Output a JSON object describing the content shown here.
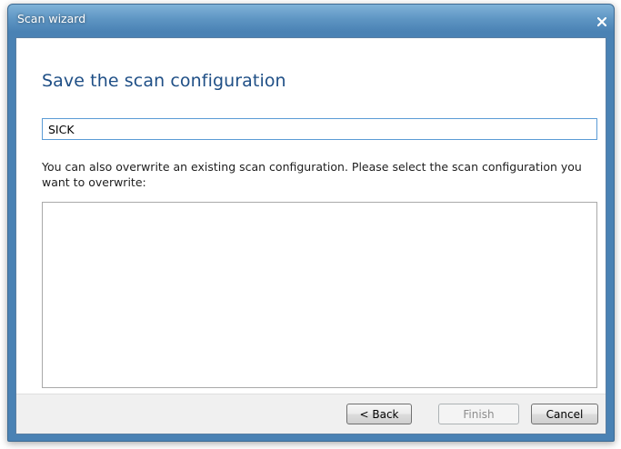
{
  "window": {
    "title": "Scan wizard"
  },
  "page": {
    "title": "Save the scan configuration",
    "name_value": "SICK",
    "instruction": "You can also overwrite an existing scan configuration. Please select the scan configuration you want to overwrite:",
    "configurations": []
  },
  "buttons": {
    "back": "< Back",
    "finish": "Finish",
    "cancel": "Cancel"
  },
  "colors": {
    "title_bar": "#4a82b4",
    "heading": "#1f4f86",
    "input_border": "#5b9bd5"
  },
  "icons": {
    "close": "close-icon"
  }
}
